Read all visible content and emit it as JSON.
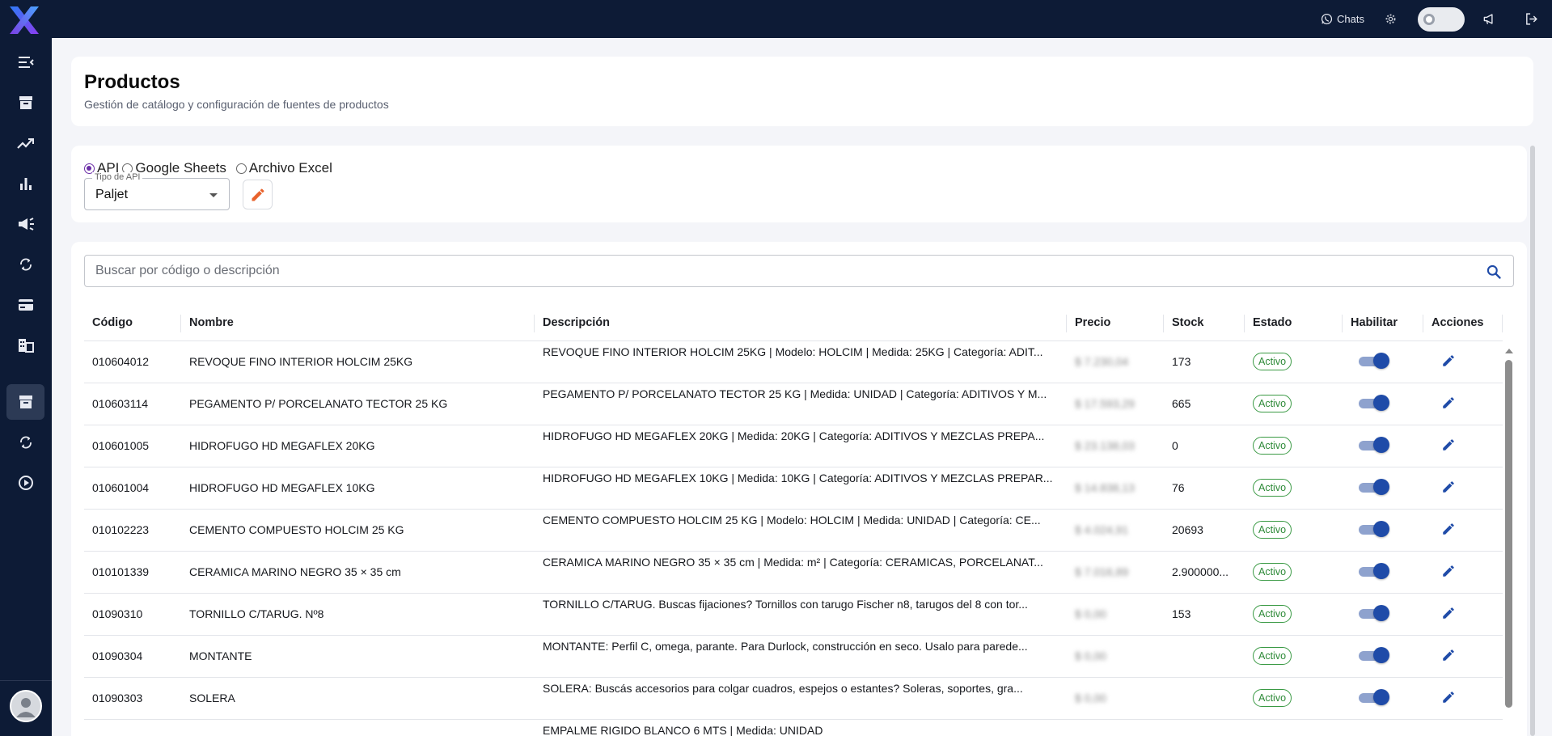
{
  "topbar": {
    "chats_label": "Chats",
    "icons": [
      "whatsapp-icon",
      "gear-icon",
      "megaphone-icon",
      "logout-icon"
    ]
  },
  "sidebar": {
    "items": [
      {
        "name": "menu-collapse-icon"
      },
      {
        "name": "archive-icon"
      },
      {
        "name": "trending-icon"
      },
      {
        "name": "bar-chart-icon"
      },
      {
        "name": "campaign-icon"
      },
      {
        "name": "sync-icon"
      },
      {
        "name": "credit-card-icon"
      },
      {
        "name": "business-icon"
      },
      {
        "name": "inventory-icon",
        "active": true
      },
      {
        "name": "sync-alt-icon"
      },
      {
        "name": "play-circle-icon"
      }
    ]
  },
  "header": {
    "title": "Productos",
    "subtitle": "Gestión de catálogo y configuración de fuentes de productos"
  },
  "source": {
    "options": [
      "API",
      "Google Sheets",
      "Archivo Excel"
    ],
    "selected": "API",
    "api_type_label": "Tipo de API",
    "api_type_value": "Paljet"
  },
  "search": {
    "placeholder": "Buscar por código o descripción"
  },
  "table": {
    "headers": {
      "codigo": "Código",
      "nombre": "Nombre",
      "descripcion": "Descripción",
      "precio": "Precio",
      "stock": "Stock",
      "estado": "Estado",
      "habilitar": "Habilitar",
      "acciones": "Acciones"
    },
    "rows": [
      {
        "codigo": "010604012",
        "nombre": "REVOQUE FINO INTERIOR HOLCIM 25KG",
        "descripcion": "REVOQUE FINO INTERIOR HOLCIM 25KG | Modelo: HOLCIM | Medida: 25KG | Categoría: ADIT...",
        "precio": "$ 7.230,04",
        "stock": "173",
        "estado": "Activo"
      },
      {
        "codigo": "010603114",
        "nombre": "PEGAMENTO P/ PORCELANATO TECTOR 25 KG",
        "descripcion": "PEGAMENTO P/ PORCELANATO TECTOR 25 KG | Medida: UNIDAD | Categoría: ADITIVOS Y M...",
        "precio": "$ 17.593,29",
        "stock": "665",
        "estado": "Activo"
      },
      {
        "codigo": "010601005",
        "nombre": "HIDROFUGO HD MEGAFLEX 20KG",
        "descripcion": "HIDROFUGO HD MEGAFLEX 20KG | Medida: 20KG | Categoría: ADITIVOS Y MEZCLAS PREPA...",
        "precio": "$ 23.138,03",
        "stock": "0",
        "estado": "Activo"
      },
      {
        "codigo": "010601004",
        "nombre": "HIDROFUGO HD MEGAFLEX 10KG",
        "descripcion": "HIDROFUGO HD MEGAFLEX 10KG | Medida: 10KG | Categoría: ADITIVOS Y MEZCLAS PREPAR...",
        "precio": "$ 14.838,13",
        "stock": "76",
        "estado": "Activo"
      },
      {
        "codigo": "010102223",
        "nombre": "CEMENTO COMPUESTO HOLCIM 25 KG",
        "descripcion": "CEMENTO COMPUESTO HOLCIM 25 KG | Modelo: HOLCIM | Medida: UNIDAD | Categoría: CE...",
        "precio": "$ 4.024,91",
        "stock": "20693",
        "estado": "Activo"
      },
      {
        "codigo": "010101339",
        "nombre": "CERAMICA MARINO NEGRO 35 × 35 cm",
        "descripcion": "CERAMICA MARINO NEGRO 35 × 35 cm | Medida: m² | Categoría: CERAMICAS, PORCELANAT...",
        "precio": "$ 7.016,89",
        "stock": "2.900000...",
        "estado": "Activo"
      },
      {
        "codigo": "01090310",
        "nombre": "TORNILLO C/TARUG. Nº8",
        "descripcion": "TORNILLO C/TARUG. Buscas fijaciones? Tornillos con tarugo Fischer n8, tarugos del 8 con tor...",
        "precio": "$ 0,00",
        "stock": "153",
        "estado": "Activo"
      },
      {
        "codigo": "01090304",
        "nombre": "MONTANTE",
        "descripcion": "MONTANTE: Perfil C, omega, parante. Para Durlock, construcción en seco. Usalo para parede...",
        "precio": "$ 0,00",
        "stock": "",
        "estado": "Activo"
      },
      {
        "codigo": "01090303",
        "nombre": "SOLERA",
        "descripcion": "SOLERA: Buscás accesorios para colgar cuadros, espejos o estantes? Soleras, soportes, gra...",
        "precio": "$ 0,00",
        "stock": "",
        "estado": "Activo"
      },
      {
        "codigo": "",
        "nombre": "",
        "descripcion": "EMPALME RIGIDO BLANCO 6 MTS | Medida: UNIDAD",
        "precio": "",
        "stock": "",
        "estado": ""
      }
    ]
  },
  "colors": {
    "navy": "#0d1b36",
    "active_green": "#2e8a38",
    "switch_blue": "#1f4ba8",
    "edit_orange": "#e8622c",
    "logo_purple": "#7b3fe4",
    "logo_blue": "#2f7bf6"
  }
}
